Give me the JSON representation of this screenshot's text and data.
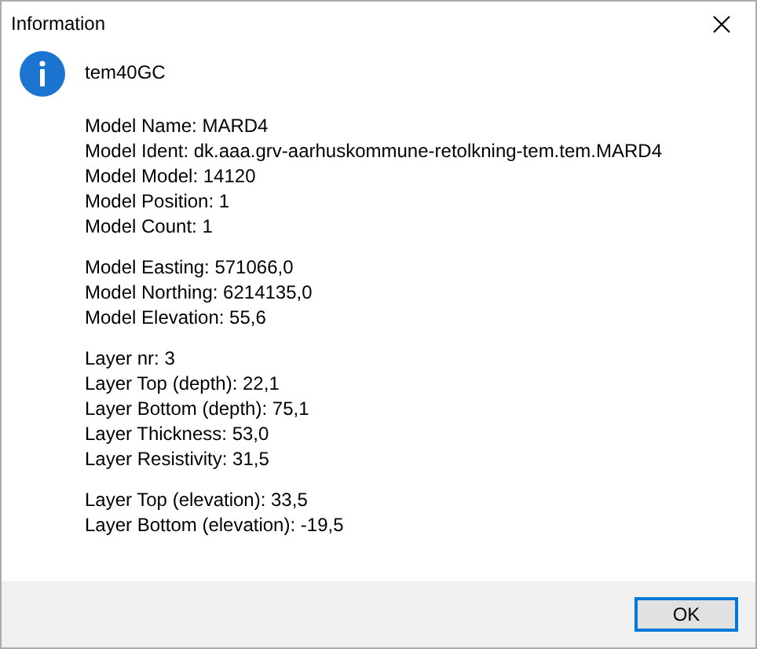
{
  "window": {
    "title": "Information"
  },
  "message": {
    "heading": "tem40GC",
    "groups": [
      [
        "Model Name: MARD4",
        "Model Ident: dk.aaa.grv-aarhuskommune-retolkning-tem.tem.MARD4",
        "Model Model: 14120",
        "Model Position: 1",
        "Model Count: 1"
      ],
      [
        "Model Easting: 571066,0",
        "Model Northing: 6214135,0",
        "Model Elevation: 55,6"
      ],
      [
        "Layer nr: 3",
        "Layer Top (depth): 22,1",
        "Layer Bottom (depth): 75,1",
        "Layer Thickness: 53,0",
        "Layer Resistivity: 31,5"
      ],
      [
        "Layer Top (elevation): 33,5",
        "Layer Bottom (elevation): -19,5"
      ]
    ]
  },
  "buttons": [
    {
      "label": "OK",
      "focused": true
    }
  ]
}
